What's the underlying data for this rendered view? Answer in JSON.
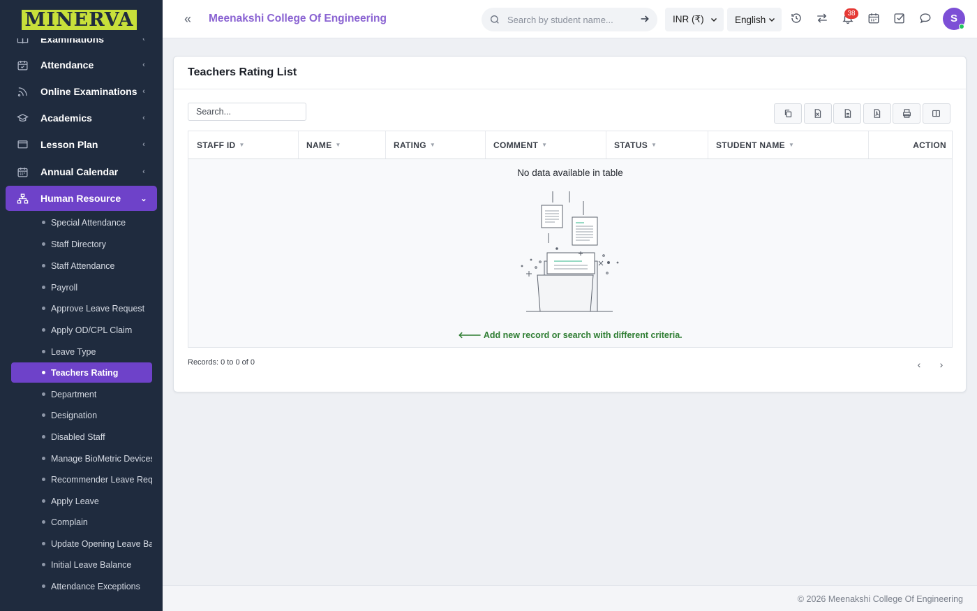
{
  "brand": {
    "logo_text": "MINERVA"
  },
  "sidebar": {
    "menu": [
      {
        "label": "Examinations",
        "icon": "book-open-icon",
        "expanded": false
      },
      {
        "label": "Attendance",
        "icon": "calendar-check-icon",
        "expanded": false
      },
      {
        "label": "Online Examinations",
        "icon": "rss-icon",
        "expanded": false
      },
      {
        "label": "Academics",
        "icon": "graduation-cap-icon",
        "expanded": false
      },
      {
        "label": "Lesson Plan",
        "icon": "monitor-icon",
        "expanded": false
      },
      {
        "label": "Annual Calendar",
        "icon": "calendar-icon",
        "expanded": false
      },
      {
        "label": "Human Resource",
        "icon": "sitemap-icon",
        "expanded": true
      }
    ],
    "submenu": [
      "Special Attendance",
      "Staff Directory",
      "Staff Attendance",
      "Payroll",
      "Approve Leave Request",
      "Apply OD/CPL Claim",
      "Leave Type",
      "Teachers Rating",
      "Department",
      "Designation",
      "Disabled Staff",
      "Manage BioMetric Devices",
      "Recommender Leave Requ",
      "Apply Leave",
      "Complain",
      "Update Opening Leave Bal",
      "Initial Leave Balance",
      "Attendance Exceptions"
    ],
    "active_submenu": "Teachers Rating"
  },
  "header": {
    "college_name": "Meenakshi College Of Engineering",
    "search_placeholder": "Search by student name...",
    "currency": "INR (₹)",
    "language": "English",
    "notification_count": "38",
    "avatar_initial": "S"
  },
  "card": {
    "title": "Teachers Rating List",
    "search_placeholder": "Search...",
    "toolbar": [
      "copy-icon",
      "excel-icon",
      "csv-icon",
      "pdf-icon",
      "print-icon",
      "columns-icon"
    ],
    "columns": [
      "STAFF ID",
      "NAME",
      "RATING",
      "COMMENT",
      "STATUS",
      "STUDENT NAME",
      "ACTION"
    ],
    "rows": [],
    "empty_message": "No data available in table",
    "empty_hint": "Add new record or search with different criteria.",
    "records_info": "Records: 0 to 0 of 0"
  },
  "footer": {
    "copyright": "© 2026 Meenakshi College Of Engineering"
  },
  "colors": {
    "sidebar_bg": "#1f2b3e",
    "accent": "#6e42c9",
    "hint_green": "#2e7d32",
    "badge_red": "#e53935"
  }
}
